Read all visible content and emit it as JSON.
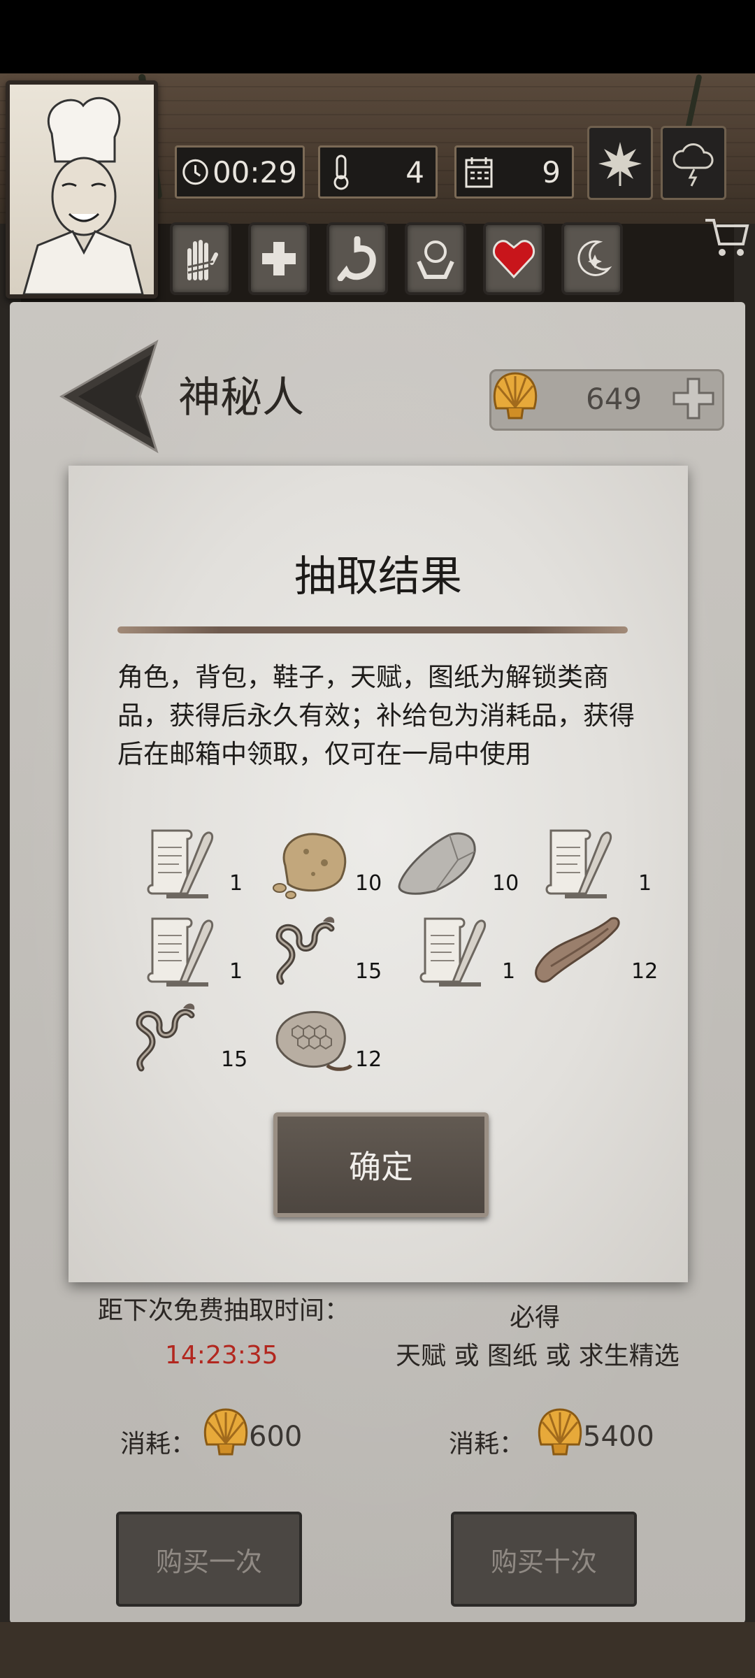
{
  "header": {
    "time": "00:29",
    "temperature": "4",
    "day": "9"
  },
  "page": {
    "title": "神秘人",
    "shell_balance": "649"
  },
  "modal": {
    "title": "抽取结果",
    "description": "角色，背包，鞋子，天赋，图纸为解锁类商品，获得后永久有效；补给包为消耗品，获得后在邮箱中领取，仅可在一局中使用",
    "items": [
      {
        "icon": "scroll-icon",
        "count": "1"
      },
      {
        "icon": "rock-icon",
        "count": "10"
      },
      {
        "icon": "stone-icon",
        "count": "10"
      },
      {
        "icon": "scroll-icon",
        "count": "1"
      },
      {
        "icon": "scroll-icon",
        "count": "1"
      },
      {
        "icon": "vine-icon",
        "count": "15"
      },
      {
        "icon": "scroll-icon",
        "count": "1"
      },
      {
        "icon": "bark-icon",
        "count": "12"
      },
      {
        "icon": "vine-icon",
        "count": "15"
      },
      {
        "icon": "honeycomb-icon",
        "count": "12"
      }
    ],
    "confirm_label": "确定"
  },
  "draw": {
    "free_label": "距下次免费抽取时间：",
    "countdown": "14:23:35",
    "guarantee_title": "必得",
    "guarantee_text": "天赋 或 图纸 或 求生精选",
    "cost_label": "消耗：",
    "cost_single": "600",
    "cost_ten": "5400",
    "buy_one_label": "购买一次",
    "buy_ten_label": "购买十次"
  },
  "colors": {
    "accent_red": "#b2271f",
    "heart": "#c8151b",
    "shell_gold": "#e7a93a"
  }
}
